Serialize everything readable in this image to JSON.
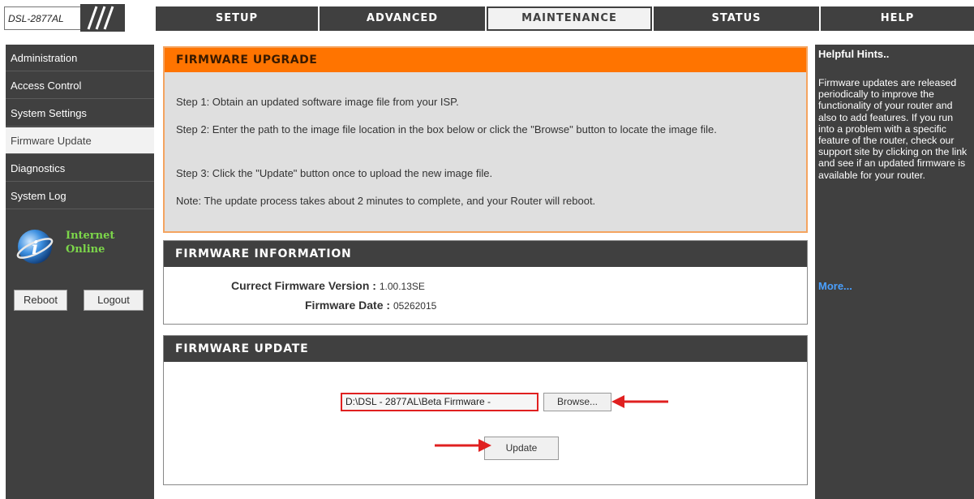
{
  "header": {
    "model": "DSL-2877AL",
    "tabs": [
      {
        "label": "SETUP"
      },
      {
        "label": "ADVANCED"
      },
      {
        "label": "MAINTENANCE"
      },
      {
        "label": "STATUS"
      },
      {
        "label": "HELP"
      }
    ],
    "active_tab": "MAINTENANCE"
  },
  "sidebar": {
    "items": [
      {
        "label": "Administration"
      },
      {
        "label": "Access Control"
      },
      {
        "label": "System Settings"
      },
      {
        "label": "Firmware Update"
      },
      {
        "label": "Diagnostics"
      },
      {
        "label": "System Log"
      }
    ],
    "active_item": "Firmware Update",
    "status_line1": "Internet",
    "status_line2": "Online",
    "status_color": "#7cd64a",
    "reboot_label": "Reboot",
    "logout_label": "Logout"
  },
  "upgrade": {
    "title": "FIRMWARE UPGRADE",
    "step1": "Step 1: Obtain an updated software image file from your ISP.",
    "step2": "Step 2: Enter the path to the image file location in the box below or click the \"Browse\" button to locate the image file.",
    "step3": "Step 3: Click the \"Update\" button once to upload the new image file.",
    "note": "Note: The update process takes about 2 minutes to complete, and your Router will reboot.",
    "accent_color": "#ff7400"
  },
  "info": {
    "title": "FIRMWARE INFORMATION",
    "version_label": "Currect Firmware Version :",
    "version_value": "1.00.13SE",
    "date_label": "Firmware Date :",
    "date_value": "05262015"
  },
  "update": {
    "title": "FIRMWARE UPDATE",
    "file_value": "D:\\DSL - 2877AL\\Beta Firmware -",
    "browse_label": "Browse...",
    "update_label": "Update",
    "highlight_color": "#e02020"
  },
  "help": {
    "title": "Helpful Hints..",
    "body": "Firmware updates are released periodically to improve the functionality of your router and also to add features. If you run into a problem with a specific feature of the router, check our support site by clicking on the link and see if an updated firmware is available for your router.",
    "more_label": "More..."
  }
}
